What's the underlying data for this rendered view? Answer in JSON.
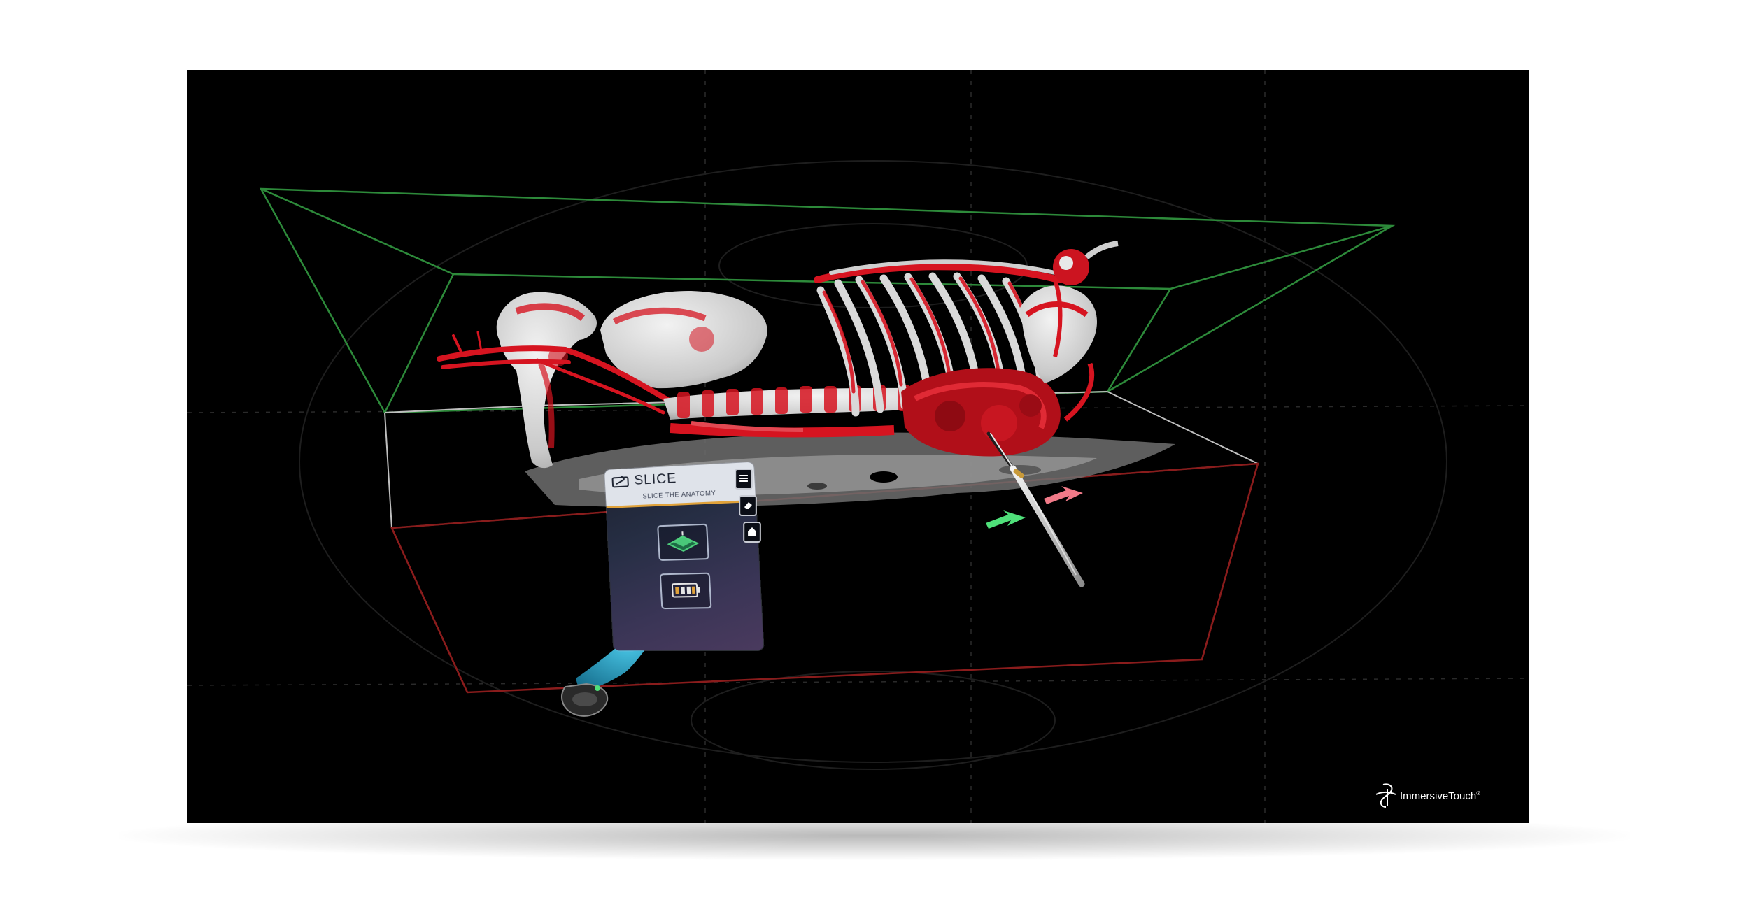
{
  "menu": {
    "title": "SLICE",
    "subtitle": "SLICE THE ANATOMY",
    "tools": [
      {
        "icon": "slice-plane-icon"
      },
      {
        "icon": "slice-battery-icon"
      }
    ],
    "side_buttons": [
      {
        "icon": "menu-icon"
      },
      {
        "icon": "eraser-icon"
      },
      {
        "icon": "home-icon"
      }
    ]
  },
  "brand": {
    "name": "ImmersiveTouch",
    "registered": "®"
  },
  "colors": {
    "anatomy_red": "#d61420",
    "bone_white": "#dcdcdc",
    "box_green": "#2d8a3a",
    "box_red": "#8a1c1c",
    "hand_cyan": "#2aa6c8",
    "arrow_green": "#4fe07a",
    "arrow_pink": "#f07a88",
    "menu_accent": "#e0a23a"
  }
}
